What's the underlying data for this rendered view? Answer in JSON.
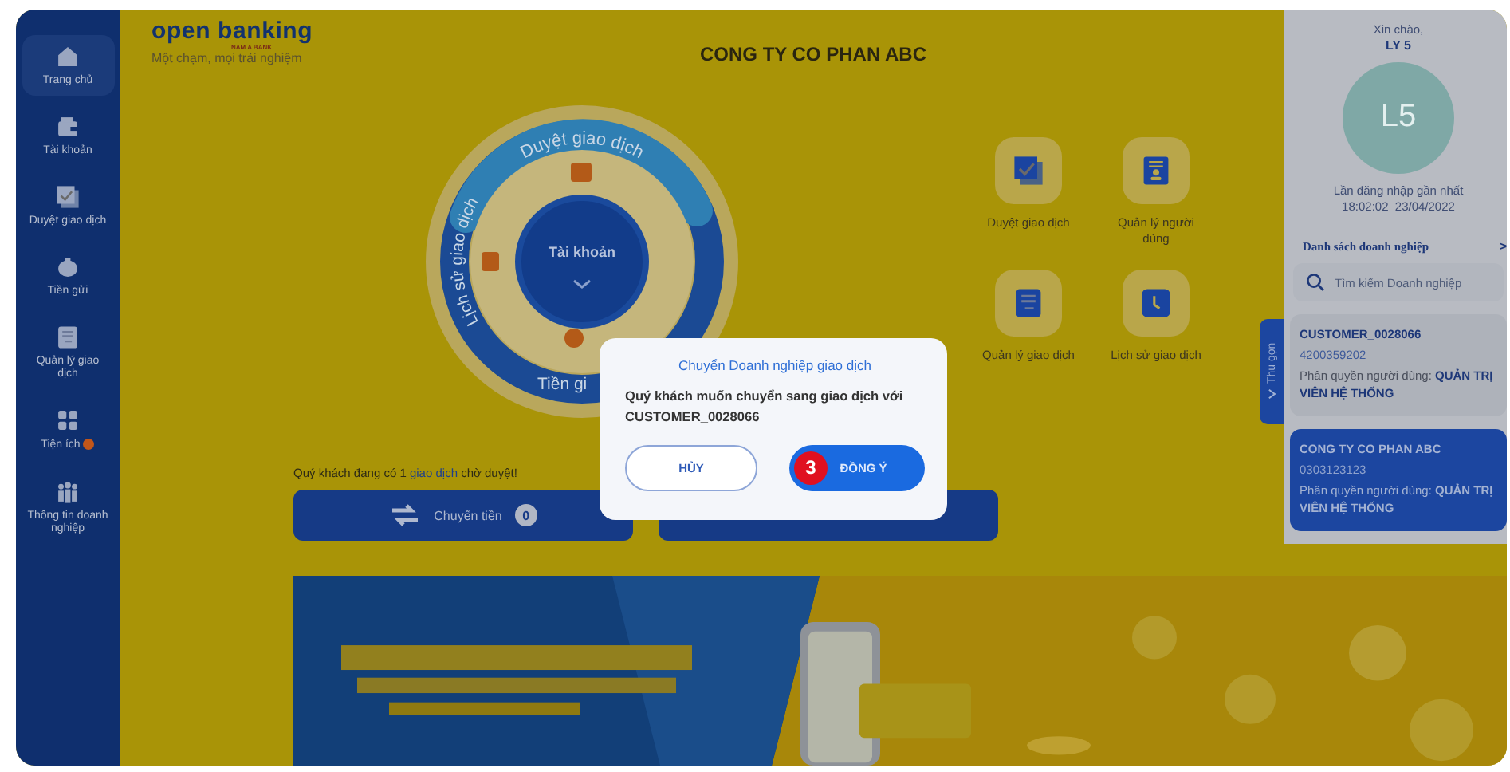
{
  "sidebar": {
    "items": [
      {
        "label": "Trang chủ",
        "selected": true,
        "badge": false
      },
      {
        "label": "Tài khoản",
        "selected": false,
        "badge": false
      },
      {
        "label": "Duyệt giao dịch",
        "selected": false,
        "badge": false
      },
      {
        "label": "Tiền gửi",
        "selected": false,
        "badge": false
      },
      {
        "label": "Quản lý giao dịch",
        "selected": false,
        "badge": false
      },
      {
        "label": "Tiện ích",
        "selected": false,
        "badge": true
      },
      {
        "label": "Thông tin doanh nghiệp",
        "selected": false,
        "badge": false
      }
    ]
  },
  "logo": {
    "name": "open banking",
    "bank": "NAM A BANK",
    "tagline": "Một chạm, mọi trải nghiệm"
  },
  "title": "CONG TY CO PHAN ABC",
  "wheel": {
    "top": "Duyệt giao dịch",
    "left": "Lịch sử giao dịch",
    "bottom": "Tiền gi",
    "center": "Tài khoản"
  },
  "shortcuts": [
    {
      "label": "Duyệt giao dịch"
    },
    {
      "label": "Quản lý người dùng"
    },
    {
      "label": "Quản lý giao dịch"
    },
    {
      "label": "Lịch sử giao dịch"
    }
  ],
  "collapse_tab": "Thu gọn",
  "pending_notice": {
    "before": "Quý khách đang có 1 ",
    "link": "giao dịch",
    "after": " chờ duyệt!"
  },
  "actions": [
    {
      "kind": "transfer",
      "label": "Chuyển tiền",
      "count": "0"
    },
    {
      "kind": "covered"
    }
  ],
  "user_panel": {
    "greeting": "Xin chào,",
    "name": "LY 5",
    "avatar": "L5",
    "last_login_label": "Lần đăng nhập gần nhất",
    "last_login": "18:02:02  23/04/2022",
    "list_title": "Danh sách doanh nghiệp",
    "list_arrow": ">",
    "search": {
      "placeholder": "Tìm kiếm Doanh nghiệp"
    },
    "companies": [
      {
        "name": "CUSTOMER_0028066",
        "tax_id": "4200359202",
        "role": "Phân quyền người dùng: **QUẢN TRỊ VIÊN HỆ THỐNG**",
        "selected": false
      },
      {
        "name": "CONG TY CO PHAN ABC",
        "tax_id": "0303123123",
        "role": "Phân quyền người dùng: **QUẢN TRỊ VIÊN HỆ THỐNG**",
        "selected": true
      }
    ]
  },
  "dialog": {
    "title": "Chuyển Doanh nghiệp giao dịch",
    "message": "Quý khách muốn chuyển sang giao dịch với CUSTOMER_0028066",
    "cancel": "HỦY",
    "confirm": "ĐỒNG Ý",
    "step": "3"
  }
}
